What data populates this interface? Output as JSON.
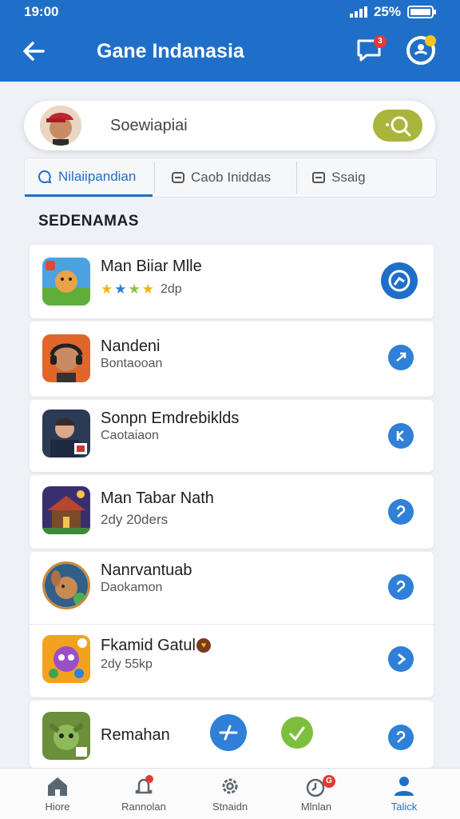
{
  "status": {
    "time": "19:00",
    "battery": "25%"
  },
  "appbar": {
    "title": "Gane Indanasia",
    "message_badge": "3"
  },
  "search": {
    "placeholder": "Soewiapiai"
  },
  "tabs": [
    {
      "label": "Nilaiipandian",
      "icon": "chat-icon"
    },
    {
      "label": "Caob Iniddas",
      "icon": "list-icon"
    },
    {
      "label": "Ssaig",
      "icon": "box-icon"
    }
  ],
  "section_title": "SEDENAMAS",
  "games": [
    {
      "name": "Man Biiar Mlle",
      "sub": "2dp",
      "rating_stars": 3
    },
    {
      "name": "Nandeni",
      "sub": "Bontaooan"
    },
    {
      "name": "Sonpn Emdrebiklds",
      "sub": "Caotaiaon"
    },
    {
      "name": "Man Tabar Nath",
      "sub": "2dy 20ders"
    },
    {
      "name": "Nanrvantuab",
      "sub": "Daokamon"
    },
    {
      "name": "Fkamid Gatul",
      "sub": "2dy 55kp"
    },
    {
      "name": "Remahan",
      "sub": ""
    }
  ],
  "nav": [
    {
      "label": "Hiore",
      "icon": "home-icon"
    },
    {
      "label": "Rannolan",
      "icon": "bell-icon"
    },
    {
      "label": "Stnaidn",
      "icon": "gear-icon"
    },
    {
      "label": "Mlnlan",
      "icon": "clock-icon",
      "badge": "G"
    },
    {
      "label": "Talick",
      "icon": "user-icon"
    }
  ],
  "colors": {
    "primary": "#1f6fc8",
    "search_button": "#a9b53b",
    "green_fab": "#7cbf3c"
  }
}
